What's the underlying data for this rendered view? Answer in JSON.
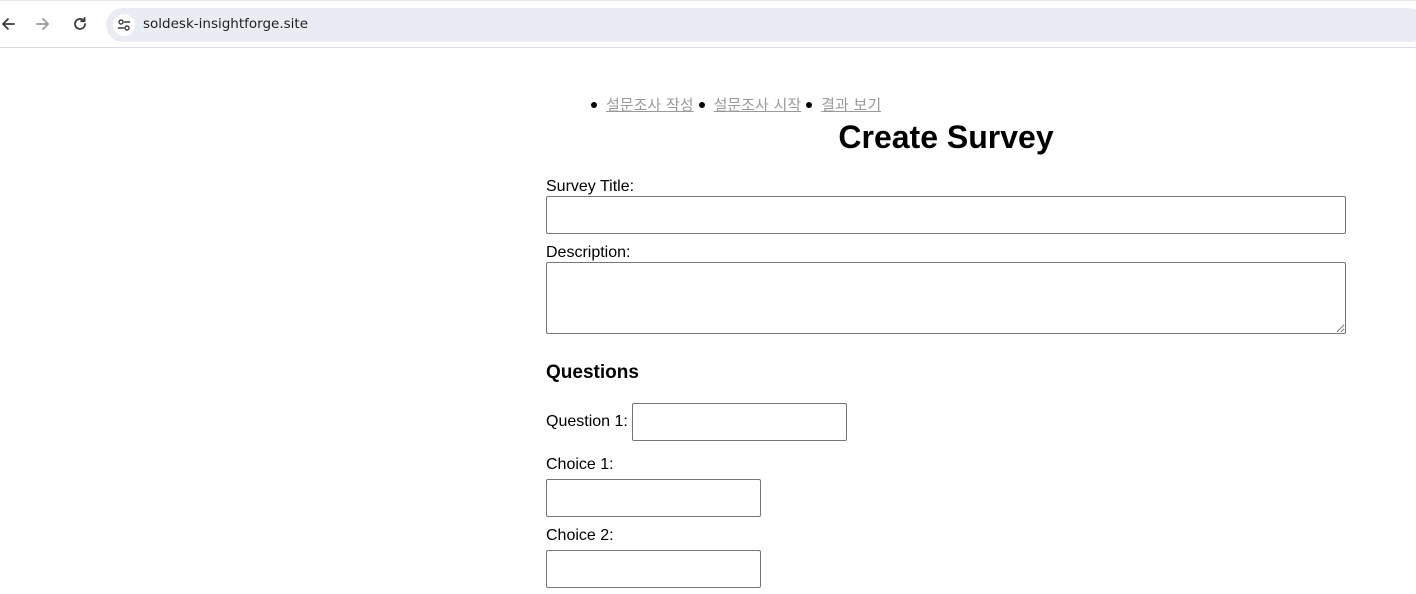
{
  "browser": {
    "url": "soldesk-insightforge.site",
    "back_icon": "arrow-left-icon",
    "forward_icon": "arrow-right-icon",
    "reload_icon": "reload-icon",
    "site_info_icon": "site-settings-icon"
  },
  "nav": {
    "items": [
      {
        "label": "설문조사 작성"
      },
      {
        "label": "설문조사 시작"
      },
      {
        "label": "결과 보기"
      }
    ],
    "link_color": "#9a9a9a"
  },
  "form": {
    "page_title": "Create Survey",
    "survey_title_label": "Survey Title:",
    "survey_title_value": "",
    "description_label": "Description:",
    "description_value": "",
    "questions_heading": "Questions",
    "question_1_label": "Question 1:",
    "question_1_value": "",
    "choice_1_label": "Choice 1:",
    "choice_1_value": "",
    "choice_2_label": "Choice 2:",
    "choice_2_value": ""
  }
}
